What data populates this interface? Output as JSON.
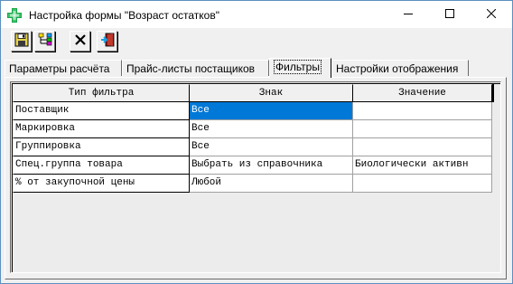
{
  "window": {
    "title": "Настройка формы \"Возраст остатков\"",
    "icon": "green-cross-icon",
    "buttons": {
      "minimize": "minimize-icon",
      "maximize": "maximize-icon",
      "close": "close-icon"
    }
  },
  "toolbar": {
    "buttons": [
      {
        "icon": "save-icon"
      },
      {
        "icon": "tree-icon"
      },
      {
        "icon": "delete-icon"
      },
      {
        "icon": "exit-icon"
      }
    ]
  },
  "tabs": [
    {
      "label": "Параметры расчёта",
      "active": false
    },
    {
      "label": "Прайс-листы постащиков",
      "active": false
    },
    {
      "label": "Фильтры",
      "active": true
    },
    {
      "label": "Настройки отображения",
      "active": false
    }
  ],
  "grid": {
    "columns": [
      "Тип фильтра",
      "Знак",
      "Значение"
    ],
    "rows": [
      {
        "type": "Поставщик",
        "sign": "Все",
        "value": "",
        "selected": true
      },
      {
        "type": "Маркировка",
        "sign": "Все",
        "value": "",
        "selected": false
      },
      {
        "type": "Группировка",
        "sign": "Все",
        "value": "",
        "selected": false
      },
      {
        "type": "Спец.группа товара",
        "sign": "Выбрать из справочника",
        "value": "Биологически активн",
        "selected": false
      },
      {
        "type": "% от закупочной цены",
        "sign": "Любой",
        "value": "",
        "selected": false
      }
    ]
  },
  "colors": {
    "selection": "#0078d7",
    "icon_green": "#1aa64a"
  }
}
